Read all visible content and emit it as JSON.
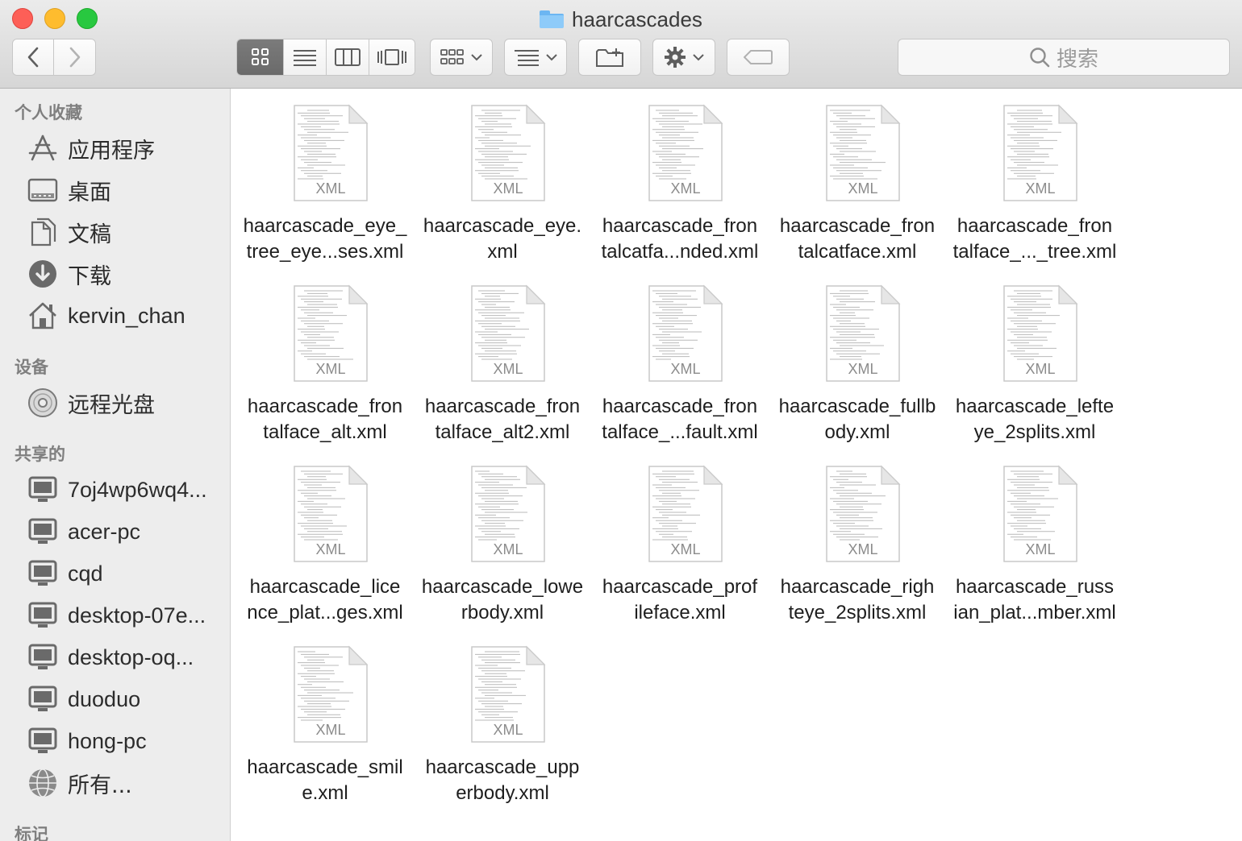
{
  "window": {
    "title": "haarcascades"
  },
  "toolbar": {
    "search_placeholder": "搜索",
    "view_modes": [
      "icon-view",
      "list-view",
      "column-view",
      "cover-flow-view"
    ],
    "active_view": "icon-view"
  },
  "sidebar": {
    "sections": {
      "favorites": "个人收藏",
      "devices": "设备",
      "shared": "共享的",
      "tags": "标记"
    },
    "favorites": [
      {
        "label": "应用程序",
        "icon": "applications-icon"
      },
      {
        "label": "桌面",
        "icon": "desktop-icon"
      },
      {
        "label": "文稿",
        "icon": "documents-icon"
      },
      {
        "label": "下载",
        "icon": "downloads-icon"
      },
      {
        "label": "kervin_chan",
        "icon": "home-icon"
      }
    ],
    "devices": [
      {
        "label": "远程光盘",
        "icon": "remote-disc-icon"
      }
    ],
    "shared": [
      {
        "label": "7oj4wp6wq4...",
        "icon": "computer-icon"
      },
      {
        "label": "acer-pc",
        "icon": "computer-icon"
      },
      {
        "label": "cqd",
        "icon": "computer-icon"
      },
      {
        "label": "desktop-07e...",
        "icon": "computer-icon"
      },
      {
        "label": "desktop-oq...",
        "icon": "computer-icon"
      },
      {
        "label": "duoduo",
        "icon": "computer-icon"
      },
      {
        "label": "hong-pc",
        "icon": "computer-icon"
      },
      {
        "label": "所有...",
        "icon": "network-globe-icon"
      }
    ]
  },
  "files": [
    {
      "line1": "haarcascade_eye_",
      "line2": "tree_eye...ses.xml",
      "badge": "XML"
    },
    {
      "line1": "haarcascade_eye.",
      "line2": "xml",
      "badge": "XML"
    },
    {
      "line1": "haarcascade_fron",
      "line2": "talcatfa...nded.xml",
      "badge": "XML"
    },
    {
      "line1": "haarcascade_fron",
      "line2": "talcatface.xml",
      "badge": "XML"
    },
    {
      "line1": "haarcascade_fron",
      "line2": "talface_..._tree.xml",
      "badge": "XML"
    },
    {
      "line1": "haarcascade_fron",
      "line2": "talface_alt.xml",
      "badge": "XML"
    },
    {
      "line1": "haarcascade_fron",
      "line2": "talface_alt2.xml",
      "badge": "XML"
    },
    {
      "line1": "haarcascade_fron",
      "line2": "talface_...fault.xml",
      "badge": "XML"
    },
    {
      "line1": "haarcascade_fullb",
      "line2": "ody.xml",
      "badge": "XML"
    },
    {
      "line1": "haarcascade_lefte",
      "line2": "ye_2splits.xml",
      "badge": "XML"
    },
    {
      "line1": "haarcascade_lice",
      "line2": "nce_plat...ges.xml",
      "badge": "XML"
    },
    {
      "line1": "haarcascade_lowe",
      "line2": "rbody.xml",
      "badge": "XML"
    },
    {
      "line1": "haarcascade_prof",
      "line2": "ileface.xml",
      "badge": "XML"
    },
    {
      "line1": "haarcascade_righ",
      "line2": "teye_2splits.xml",
      "badge": "XML"
    },
    {
      "line1": "haarcascade_russ",
      "line2": "ian_plat...mber.xml",
      "badge": "XML"
    },
    {
      "line1": "haarcascade_smil",
      "line2": "e.xml",
      "badge": "XML"
    },
    {
      "line1": "haarcascade_upp",
      "line2": "erbody.xml",
      "badge": "XML"
    }
  ]
}
